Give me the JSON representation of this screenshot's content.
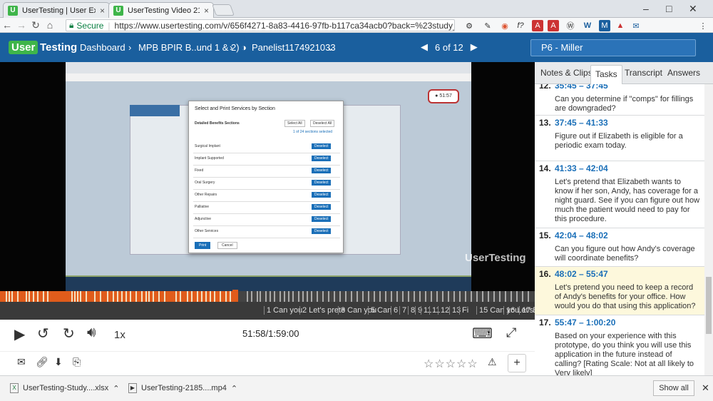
{
  "browser": {
    "tabs": [
      {
        "title": "UserTesting | User Expe",
        "favicon": "U"
      },
      {
        "title": "UserTesting Video 2185",
        "favicon": "U"
      }
    ],
    "secure_label": "Secure",
    "url": "https://www.usertesting.com/v/656f4271-8a83-4416-97fb-b117ca34acb0?back=%23study_2185708#/tas",
    "window_controls": [
      "–",
      "□",
      "✕"
    ],
    "extension_icons": [
      "gear-icon",
      "eyedropper-icon",
      "color-wheel-icon",
      "fx-icon",
      "question-icon",
      "pdf-icon",
      "pdf-icon",
      "wordpress-icon",
      "w-icon",
      "m-icon",
      "bookmark-icon",
      "mail-icon",
      "menu-icon"
    ],
    "ext_labels": [
      "⚙",
      "✎",
      "◉",
      "f?",
      "?",
      "A",
      "A",
      "Ⓦ",
      "W",
      "M",
      "▲",
      "✉",
      "⋮"
    ]
  },
  "header": {
    "logo_text_1": "User",
    "logo_text_2": "Testing",
    "breadcrumb_1": "Dashboard",
    "breadcrumb_2": "MPB BPIR B..und 1 & 2)",
    "panelist": "Panelist1174921033",
    "pager": "6 of 12",
    "participant": "P6 - Miller"
  },
  "player": {
    "timecode": "51:58/1:59:00",
    "speed": "1x",
    "progress_fraction": 0.44,
    "task_markers": [
      "1 Can you",
      "2 Let's prete",
      "3 Can you",
      "5 Can",
      "6",
      "7",
      "8",
      "9",
      "11",
      "11",
      "12",
      "13",
      "Fi",
      "15 Can you",
      "16 Let's pre",
      "17 Ba"
    ],
    "watermark": "UserTesting"
  },
  "panel": {
    "tabs": [
      "Notes & Clips",
      "Tasks",
      "Transcript",
      "Answers"
    ],
    "active_tab": "Tasks",
    "tasks": [
      {
        "num": "12.",
        "range": "35:45 – 37:45",
        "desc": "Can you determine if \"comps\" for fillings are downgraded?"
      },
      {
        "num": "13.",
        "range": "37:45 – 41:33",
        "desc": "Figure out if Elizabeth is eligible for a periodic exam today."
      },
      {
        "num": "14.",
        "range": "41:33 – 42:04",
        "desc": "Let's pretend that Elizabeth wants to know if her son, Andy, has coverage for a night guard. See if you can figure out how much the patient would need to pay for this procedure."
      },
      {
        "num": "15.",
        "range": "42:04 – 48:02",
        "desc": "Can you figure out how Andy's coverage will coordinate benefits?"
      },
      {
        "num": "16.",
        "range": "48:02 – 55:47",
        "desc": "Let's pretend you need to keep a record of Andy's benefits for your office. How would you do that using this application?"
      },
      {
        "num": "17.",
        "range": "55:47 – 1:00:20",
        "desc": "Based on your experience with this prototype, do you think you will use this application in the future instead of calling? [Rating Scale: Not at all likely to Very likely]"
      }
    ]
  },
  "modal": {
    "title": "Select and Print Services by Section",
    "section_header": "Detailed Benefits Sections",
    "select_all": "Select All",
    "deselect_all": "Deselect All",
    "count": "1 of 24 sections selected",
    "rows": [
      "Surgical Implant",
      "Implant Supported",
      "Fixed",
      "Oral Surgery",
      "Other Repairs",
      "Palliative",
      "Adjunctive",
      "Other Services"
    ],
    "row_button": "Deselect",
    "print": "Print",
    "cancel": "Cancel"
  },
  "downloads": {
    "items": [
      "UserTesting-Study....xlsx",
      "UserTesting-2185....mp4"
    ],
    "show_all": "Show all"
  },
  "rating_stars": "☆☆☆☆☆",
  "colors": {
    "brand_blue": "#1a5f9e",
    "brand_green": "#3fb54a",
    "timeline_orange": "#e05c1b",
    "task_blue": "#1a6fb8",
    "highlight": "#fdf8dc"
  }
}
